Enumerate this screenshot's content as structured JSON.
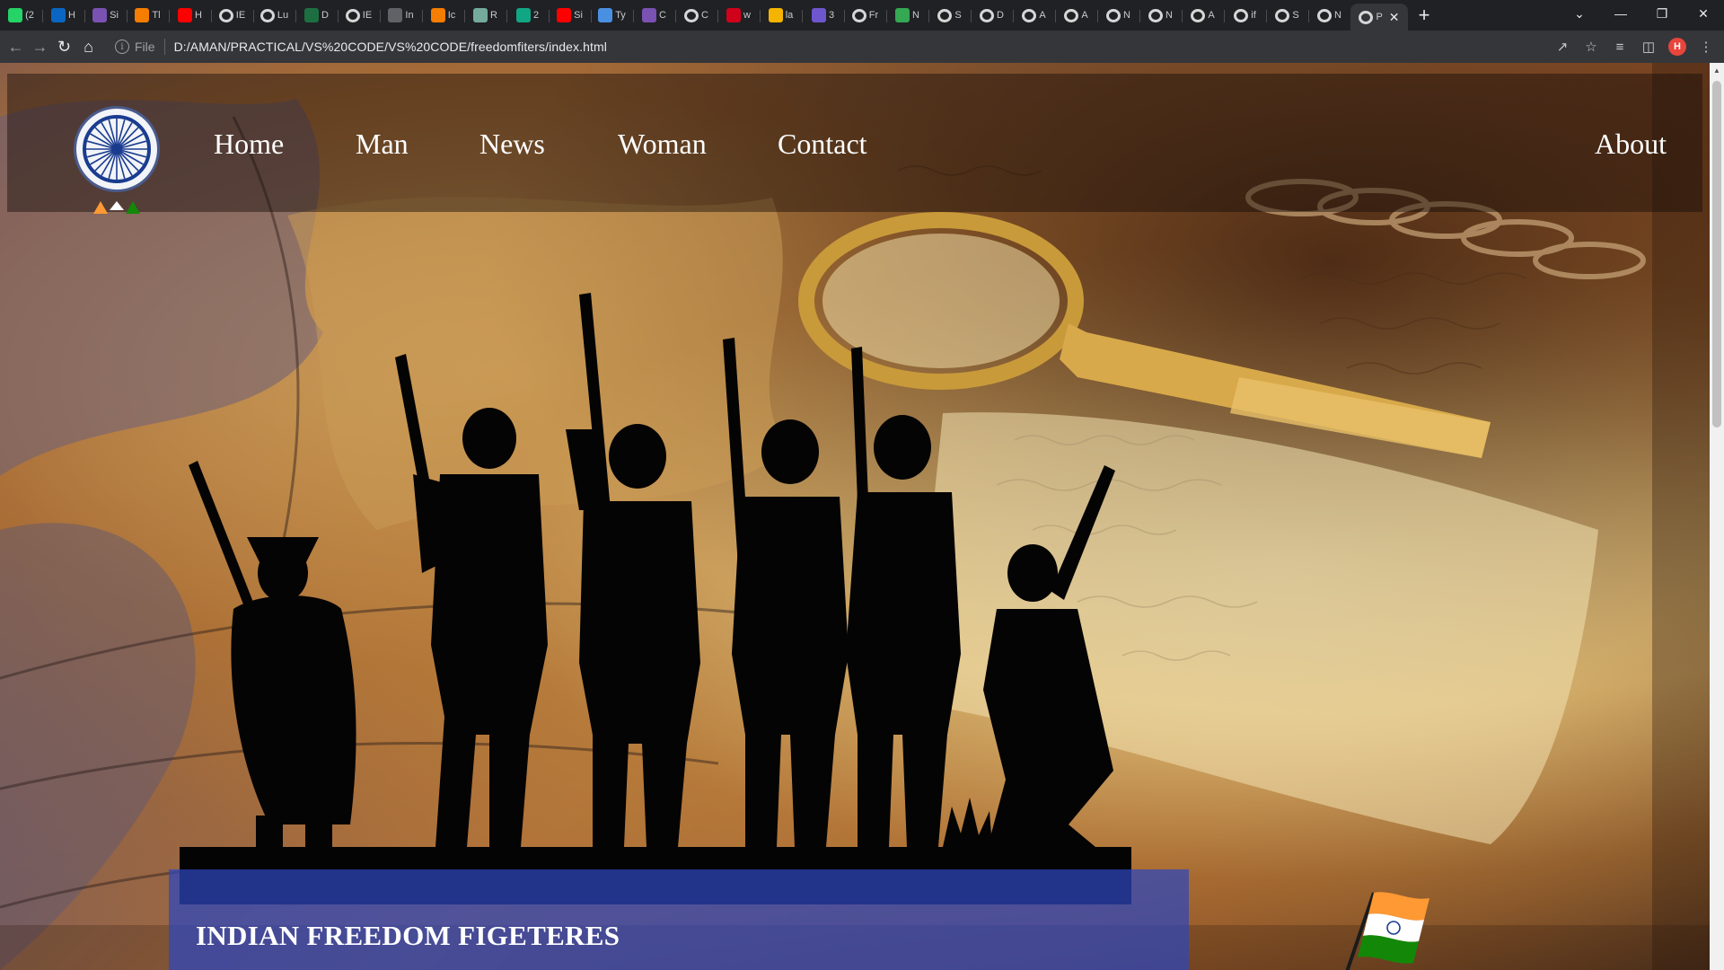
{
  "browser": {
    "tabs": [
      {
        "icon": "whatsapp-icon",
        "title": "(2",
        "color": "#25d366"
      },
      {
        "icon": "onedrive-icon",
        "title": "H",
        "color": "#0a66c2"
      },
      {
        "icon": "bootstrap-icon",
        "title": "Si",
        "color": "#7952b3"
      },
      {
        "icon": "blogger-icon",
        "title": "Tl",
        "color": "#f57d00"
      },
      {
        "icon": "youtube-icon",
        "title": "H",
        "color": "#ff0000"
      },
      {
        "icon": "globe-icon",
        "title": "IE",
        "color": "ring"
      },
      {
        "icon": "globe-icon",
        "title": "Lu",
        "color": "ring"
      },
      {
        "icon": "excel-icon",
        "title": "D",
        "color": "#1d6f42"
      },
      {
        "icon": "globe-icon",
        "title": "IE",
        "color": "ring"
      },
      {
        "icon": "target-icon",
        "title": "In",
        "color": "#5f6368"
      },
      {
        "icon": "blogger-icon",
        "title": "Ic",
        "color": "#f57d00"
      },
      {
        "icon": "chatgpt-icon",
        "title": "R",
        "color": "#74aa9c"
      },
      {
        "icon": "grammarly-icon",
        "title": "2",
        "color": "#11a683"
      },
      {
        "icon": "youtube-icon",
        "title": "Si",
        "color": "#ff0000"
      },
      {
        "icon": "text-icon",
        "title": "Ty",
        "color": "#4a90e2"
      },
      {
        "icon": "bootstrap-icon",
        "title": "C",
        "color": "#7952b3"
      },
      {
        "icon": "globe-icon",
        "title": "C",
        "color": "ring"
      },
      {
        "icon": "aws-icon",
        "title": "w",
        "color": "#d0021b"
      },
      {
        "icon": "folder-icon",
        "title": "la",
        "color": "#f4b400"
      },
      {
        "icon": "a-icon",
        "title": "3",
        "color": "#6e56cf"
      },
      {
        "icon": "globe-icon",
        "title": "Fr",
        "color": "ring"
      },
      {
        "icon": "leaf-icon",
        "title": "N",
        "color": "#34a853"
      },
      {
        "icon": "globe-icon",
        "title": "S",
        "color": "ring"
      },
      {
        "icon": "globe-icon",
        "title": "D",
        "color": "ring"
      },
      {
        "icon": "globe-icon",
        "title": "A",
        "color": "ring"
      },
      {
        "icon": "globe-icon",
        "title": "A",
        "color": "ring"
      },
      {
        "icon": "globe-icon",
        "title": "N",
        "color": "ring"
      },
      {
        "icon": "globe-icon",
        "title": "N",
        "color": "ring"
      },
      {
        "icon": "globe-icon",
        "title": "A",
        "color": "ring"
      },
      {
        "icon": "globe-icon",
        "title": "if",
        "color": "ring"
      },
      {
        "icon": "globe-icon",
        "title": "S",
        "color": "ring"
      },
      {
        "icon": "globe-icon",
        "title": "N",
        "color": "ring"
      },
      {
        "icon": "globe-icon",
        "title": "P",
        "color": "ring"
      }
    ],
    "scheme": "File",
    "url": "D:/AMAN/PRACTICAL/VS%20CODE/VS%20CODE/freedomfiters/index.html",
    "profile_initial": "H"
  },
  "site": {
    "nav": {
      "home": "Home",
      "man": "Man",
      "news": "News",
      "woman": "Woman",
      "contact": "Contact",
      "about": "About"
    },
    "title": "INDIAN FREEDOM FIGETERES"
  },
  "colors": {
    "title_box": "#2d46be",
    "saffron": "#ff9933",
    "green": "#138808",
    "chakra": "#1a3c8f"
  }
}
